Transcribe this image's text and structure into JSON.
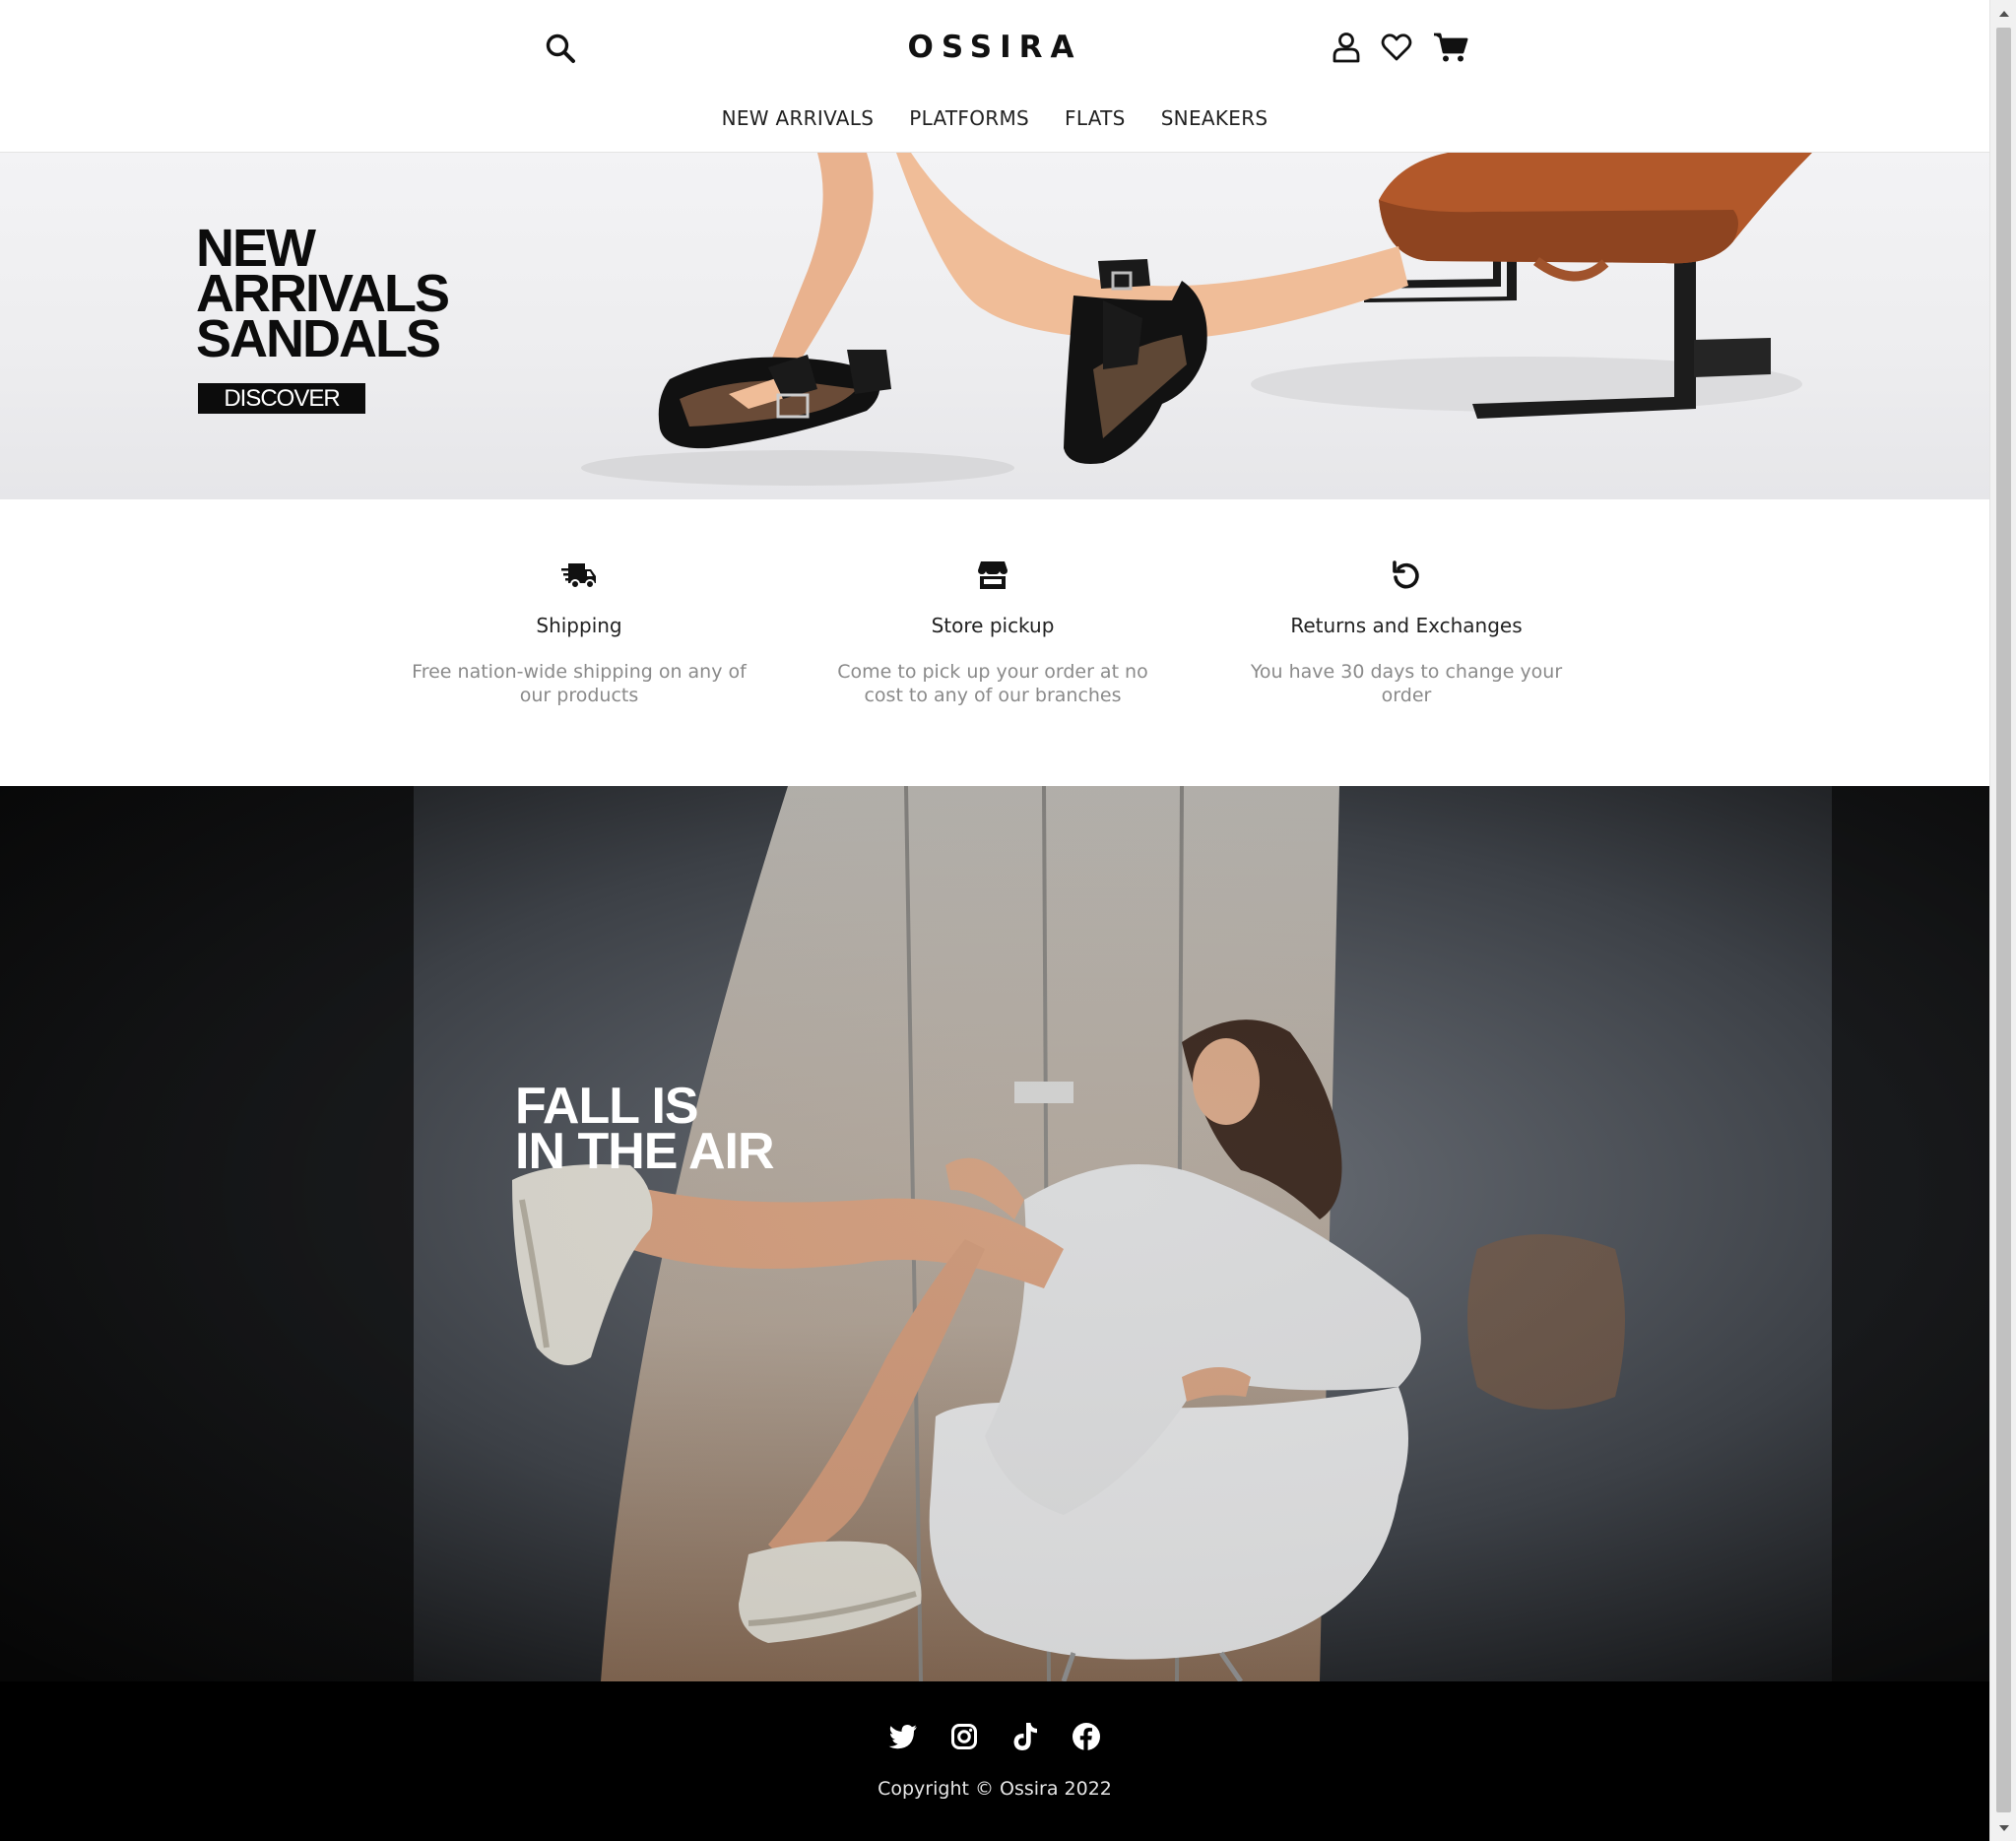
{
  "brand": {
    "logo": "OSSIRA"
  },
  "header": {
    "icons": [
      "search-icon",
      "user-icon",
      "heart-icon",
      "cart-icon"
    ]
  },
  "nav": {
    "items": [
      {
        "label": "NEW ARRIVALS"
      },
      {
        "label": "PLATFORMS"
      },
      {
        "label": "FLATS"
      },
      {
        "label": "SNEAKERS"
      }
    ]
  },
  "hero1": {
    "title_lines": [
      "NEW",
      "ARRIVALS",
      "SANDALS"
    ],
    "cta": "DISCOVER"
  },
  "features": [
    {
      "icon": "truck-icon",
      "title": "Shipping",
      "desc": "Free nation-wide shipping on any of our products"
    },
    {
      "icon": "store-icon",
      "title": "Store pickup",
      "desc": "Come to pick up your order at no cost to any of our branches"
    },
    {
      "icon": "return-icon",
      "title": "Returns and Exchanges",
      "desc": "You have 30 days to change your order"
    }
  ],
  "hero2": {
    "title_lines": [
      "FALL IS",
      "IN THE AIR"
    ]
  },
  "footer": {
    "socials": [
      "twitter-icon",
      "instagram-icon",
      "tiktok-icon",
      "facebook-icon"
    ],
    "copyright": "Copyright © Ossira 2022"
  },
  "colors": {
    "text": "#111111",
    "muted": "#8a8a8a",
    "footer_bg": "#000000",
    "cta_bg": "#0c0c0c"
  }
}
